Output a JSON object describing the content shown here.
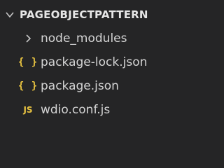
{
  "explorer": {
    "section_title": "PAGEOBJECTPATTERN",
    "items": [
      {
        "label": "node_modules",
        "type": "folder",
        "icon": "chevron-right-icon"
      },
      {
        "label": "package-lock.json",
        "type": "json",
        "icon": "json-icon",
        "icon_glyph": "{ }"
      },
      {
        "label": "package.json",
        "type": "json",
        "icon": "json-icon",
        "icon_glyph": "{ }"
      },
      {
        "label": "wdio.conf.js",
        "type": "js",
        "icon": "javascript-icon",
        "icon_glyph": "JS"
      }
    ]
  },
  "colors": {
    "background": "#252526",
    "text": "#d4d4d4",
    "header_text": "#e6e6e6",
    "json_icon": "#e8c341",
    "js_icon": "#e8c341"
  }
}
